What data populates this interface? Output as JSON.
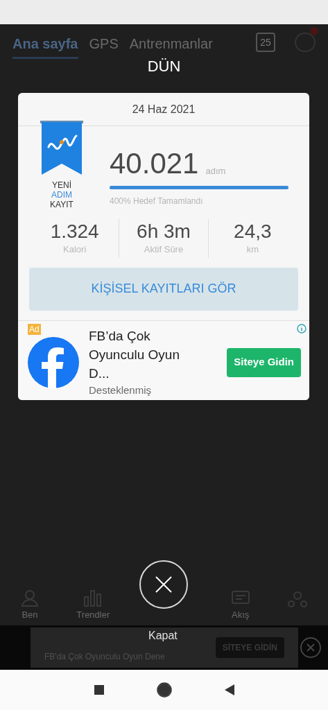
{
  "background_app": {
    "tabs": [
      {
        "label": "Ana sayfa",
        "selected": true
      },
      {
        "label": "GPS",
        "selected": false
      },
      {
        "label": "Antrenmanlar",
        "selected": false
      }
    ],
    "calendar_day": "25",
    "nav": [
      {
        "label": "Ben",
        "kind": "person"
      },
      {
        "label": "Trendler",
        "kind": "bars"
      },
      {
        "label": "Akış",
        "kind": "feed"
      }
    ],
    "banner_ad": {
      "title": "FB'da Çok Oyunculu Oyun Dene",
      "button": "SİTEYE GİDİN"
    }
  },
  "dialog": {
    "heading": "DÜN",
    "date": "24 Haz 2021",
    "badge_lines": [
      {
        "text": "YENİ",
        "highlight": false
      },
      {
        "text": "ADIM",
        "highlight": true
      },
      {
        "text": "KAYIT",
        "highlight": false
      }
    ],
    "steps": "40.021",
    "steps_unit": "adım",
    "goal_progress": {
      "level": 1
    },
    "goal_text": "400% Hedef Tamamlandı",
    "stats": [
      {
        "value": "1.324",
        "label": "Kalori"
      },
      {
        "value": "6h 3m",
        "label": "Aktif Süre"
      },
      {
        "value": "24,3",
        "label": "km"
      }
    ],
    "button": "KİŞİSEL KAYITLARI GÖR",
    "ad": {
      "badge": "Ad",
      "title": "FB’da Çok Oyunculu Oyun D...",
      "sponsor": "Desteklenmiş",
      "button": "Siteye Gidin"
    },
    "close_label": "Kapat"
  }
}
